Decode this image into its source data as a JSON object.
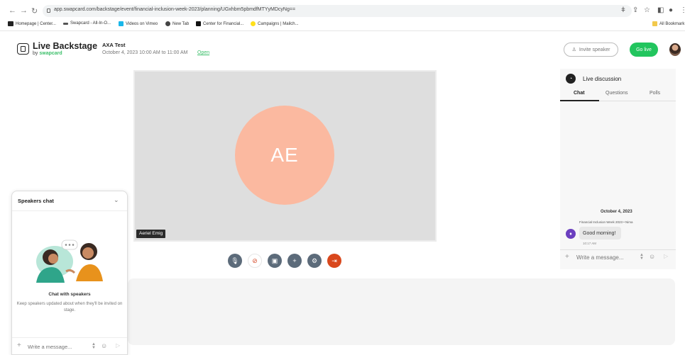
{
  "browser": {
    "url": "app.swapcard.com/backstage/event/financial-inclusion-week-2023/planning/UGxhbm5pbmdfMTYyMDcyNg==",
    "bookmarks": [
      {
        "label": "Homepage | Center...",
        "icon": "cfi-logo-icon",
        "color": "#222222"
      },
      {
        "label": "Swapcard - All-In-O...",
        "icon": "swapcard-icon",
        "color": "#555555"
      },
      {
        "label": "Videos on Vimeo",
        "icon": "vimeo-icon",
        "color": "#1ab7ea"
      },
      {
        "label": "New Tab",
        "icon": "globe-icon",
        "color": "#444444"
      },
      {
        "label": "Center for Financial...",
        "icon": "x-logo-icon",
        "color": "#111111"
      },
      {
        "label": "Campaigns | Mailch...",
        "icon": "mailchimp-icon",
        "color": "#ffe01b"
      }
    ],
    "all_bookmarks": "All Bookmark"
  },
  "header": {
    "logo_title": "Live Backstage",
    "logo_by": "by",
    "logo_brand": "swapcard",
    "event_name": "AXA Test",
    "event_date": "October 4, 2023 10:00 AM to 11:00 AM",
    "open_link": "Open",
    "invite_label": "Invite speaker",
    "golive_label": "Go live"
  },
  "stage": {
    "initials": "AE",
    "speaker_name": "Aeriel Emig",
    "avatar_color": "#fbb9a0"
  },
  "controls": [
    {
      "name": "microphone-button",
      "icon": "microphone-icon",
      "glyph": "🎙"
    },
    {
      "name": "camera-off-button",
      "icon": "camera-off-icon",
      "glyph": "⊘"
    },
    {
      "name": "screen-share-button",
      "icon": "screen-share-icon",
      "glyph": "▣"
    },
    {
      "name": "add-button",
      "icon": "plus-icon",
      "glyph": "+"
    },
    {
      "name": "settings-button",
      "icon": "gear-icon",
      "glyph": "⚙"
    },
    {
      "name": "leave-button",
      "icon": "exit-icon",
      "glyph": "⇥"
    }
  ],
  "live_discussion": {
    "title": "Live discussion",
    "tabs": [
      "Chat",
      "Questions",
      "Polls"
    ],
    "active_tab": "Chat",
    "messages": [
      {
        "date": "October 4, 2023",
        "sender": "Financial Inclusion Week 2023 • Nima",
        "text": "Good morning!",
        "time": "10:17 AM"
      }
    ],
    "input_placeholder": "Write a message..."
  },
  "speakers_chat": {
    "title": "Speakers chat",
    "heading": "Chat with speakers",
    "description": "Keep speakers updated about when they'll be invited on stage.",
    "input_placeholder": "Write a message..."
  },
  "colors": {
    "accent_green": "#22c55e",
    "leave_red": "#d9481d",
    "control_gray": "#5c6b7a"
  }
}
